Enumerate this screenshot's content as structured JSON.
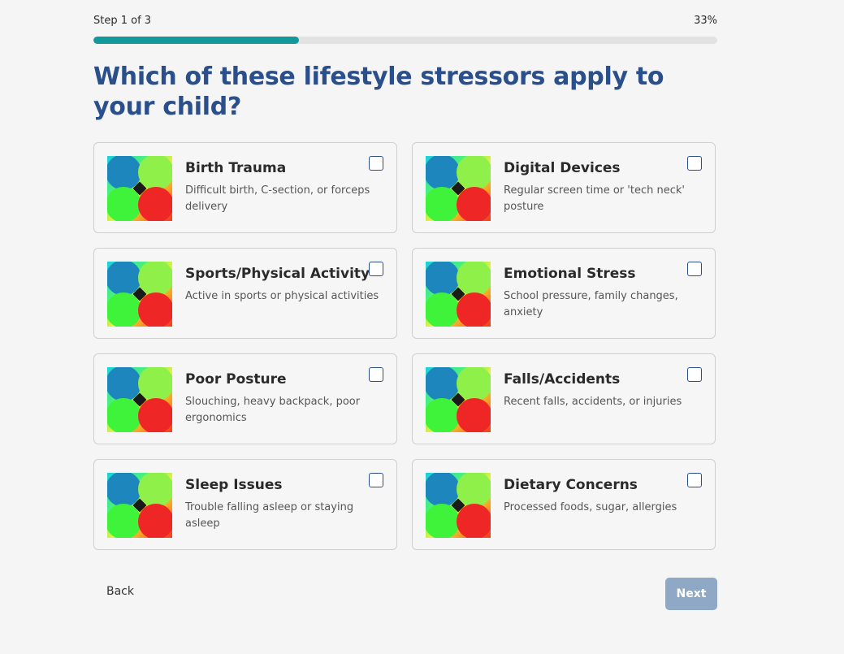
{
  "progress": {
    "step_label": "Step 1 of 3",
    "percent_label": "33%",
    "value": 0.33
  },
  "question": "Which of these lifestyle stressors apply to your child?",
  "options": [
    {
      "title": "Birth Trauma",
      "description": "Difficult birth, C-section, or forceps delivery",
      "checked": false
    },
    {
      "title": "Digital Devices",
      "description": "Regular screen time or 'tech neck' posture",
      "checked": false
    },
    {
      "title": "Sports/Physical Activity",
      "description": "Active in sports or physical activities",
      "checked": false
    },
    {
      "title": "Emotional Stress",
      "description": "School pressure, family changes, anxiety",
      "checked": false
    },
    {
      "title": "Poor Posture",
      "description": "Slouching, heavy backpack, poor ergonomics",
      "checked": false
    },
    {
      "title": "Falls/Accidents",
      "description": "Recent falls, accidents, or injuries",
      "checked": false
    },
    {
      "title": "Sleep Issues",
      "description": "Trouble falling asleep or staying asleep",
      "checked": false
    },
    {
      "title": "Dietary Concerns",
      "description": "Processed foods, sugar, allergies",
      "checked": false
    }
  ],
  "nav": {
    "back_label": "Back",
    "next_label": "Next"
  },
  "colors": {
    "progress_fill": "#13999a",
    "heading": "#2a4f8b",
    "next_button_disabled": "#8ea8c6"
  }
}
